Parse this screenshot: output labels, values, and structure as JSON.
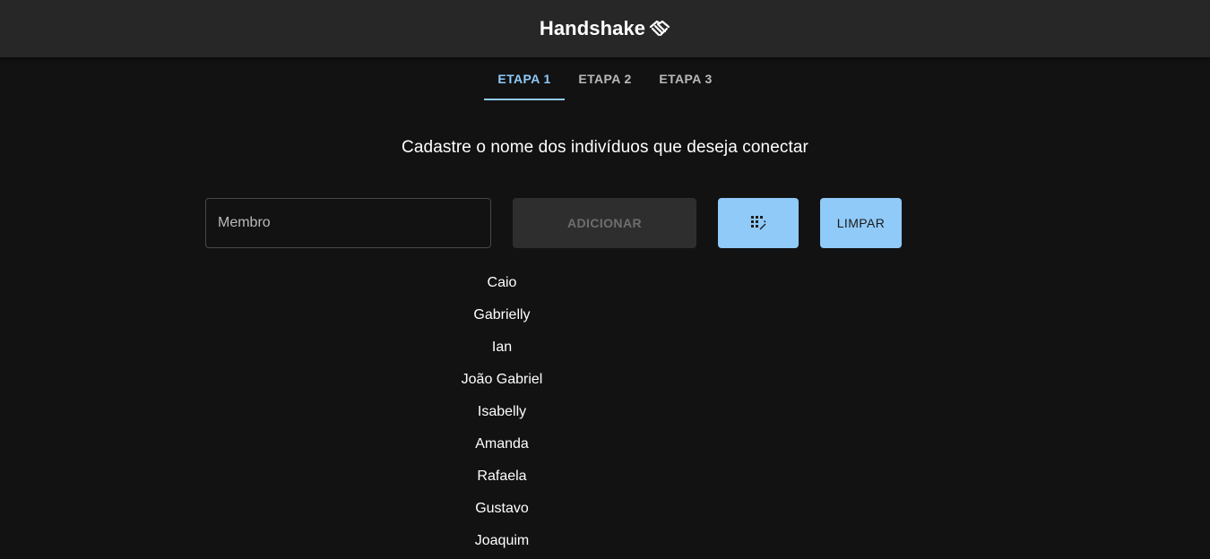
{
  "appbar": {
    "title": "Handshake",
    "logo_icon": "handshake-icon"
  },
  "tabs": [
    {
      "label": "ETAPA 1",
      "active": true
    },
    {
      "label": "ETAPA 2",
      "active": false
    },
    {
      "label": "ETAPA 3",
      "active": false
    }
  ],
  "main": {
    "heading": "Cadastre o nome dos indivíduos que deseja conectar",
    "member_input": {
      "placeholder": "Membro",
      "value": ""
    },
    "add_button": {
      "label": "ADICIONAR",
      "disabled": true
    },
    "shuffle_button": {
      "icon": "shuffle-grid-icon"
    },
    "clear_button": {
      "label": "LIMPAR"
    },
    "members": [
      "Caio",
      "Gabrielly",
      "Ian",
      "João Gabriel",
      "Isabelly",
      "Amanda",
      "Rafaela",
      "Gustavo",
      "Joaquim"
    ]
  },
  "colors": {
    "accent": "#90caf9",
    "background": "#121212",
    "appbar": "#272727"
  }
}
